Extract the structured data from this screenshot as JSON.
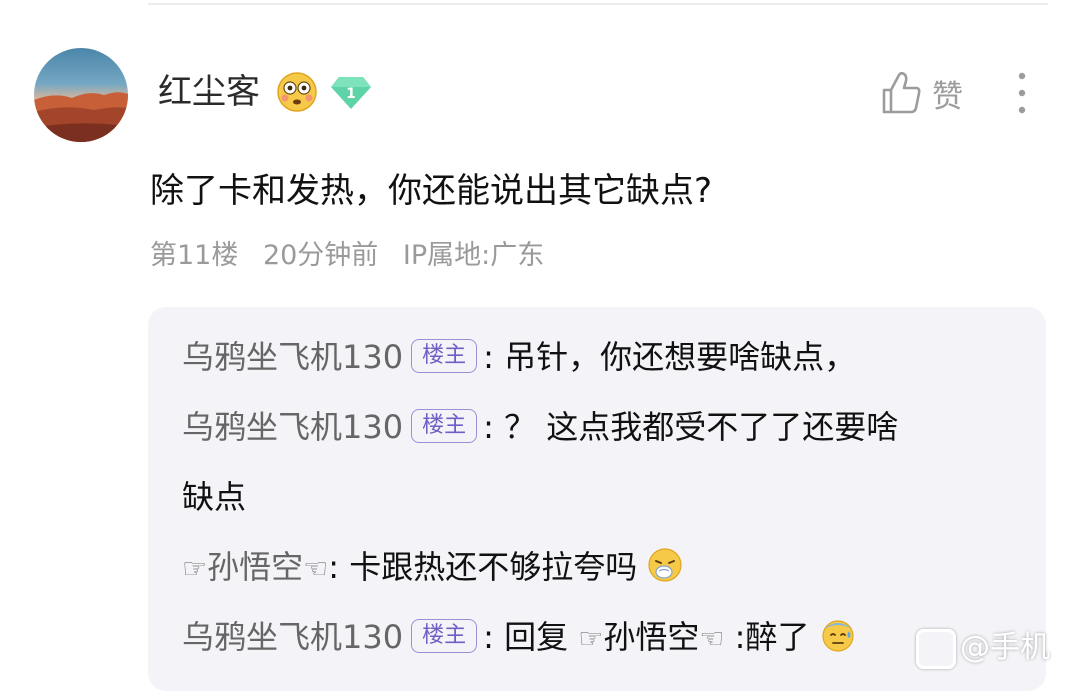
{
  "comment": {
    "username": "红尘客",
    "level": "1",
    "like_label": "赞",
    "text": "除了卡和发热，你还能说出其它缺点?",
    "floor": "第11楼",
    "time": "20分钟前",
    "ip": "IP属地:广东"
  },
  "replies": [
    {
      "name": "乌鸦坐飞机130",
      "badge": "楼主",
      "text": "吊针，你还想要啥缺点，"
    },
    {
      "name": "乌鸦坐飞机130",
      "badge": "楼主",
      "text": "？ 这点我都受不了了还要啥",
      "text2": "缺点"
    },
    {
      "name": "孙悟空",
      "text": "卡跟热还不够拉夸吗"
    },
    {
      "name": "乌鸦坐飞机130",
      "badge": "楼主",
      "text": "回复 ",
      "mention": "孙悟空",
      "text_after": " :醉了"
    }
  ],
  "colon": ":",
  "hands": {
    "left": "☞",
    "right": "☜"
  },
  "watermark": "@手机"
}
